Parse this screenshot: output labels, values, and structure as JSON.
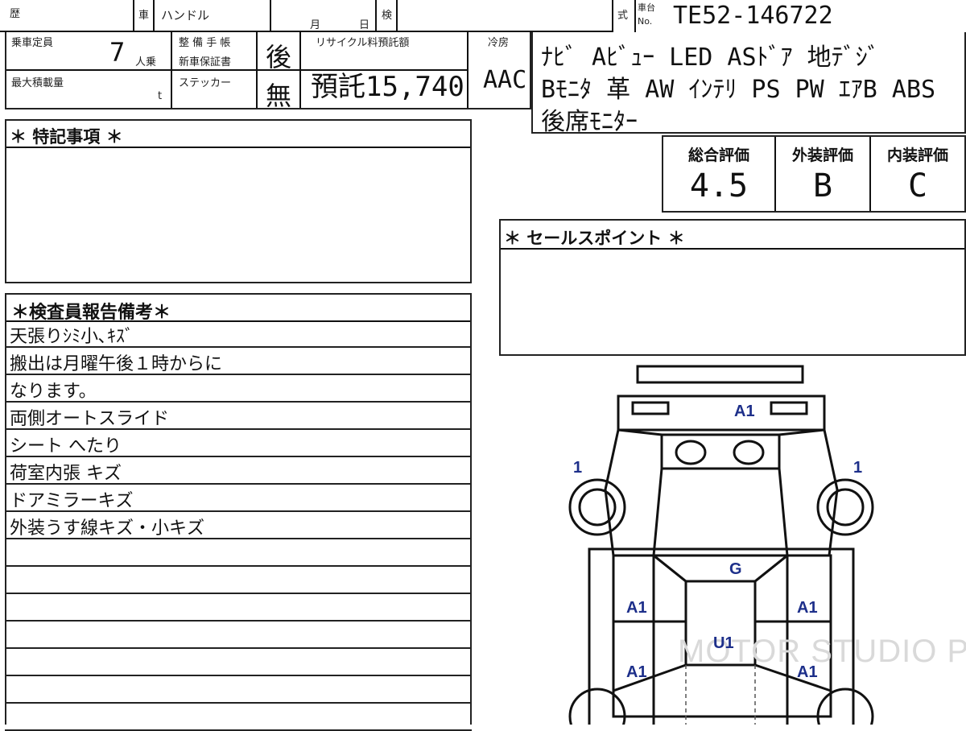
{
  "header": {
    "reki_label": "歴",
    "sha_label": "車",
    "handle_label": "ハンドル",
    "month_label": "月",
    "day_label": "日",
    "ken_label": "検",
    "shiki_label": "式",
    "chassis_label_top": "車台",
    "chassis_label_bottom": "No.",
    "chassis_no": "TE52-146722"
  },
  "specs": {
    "capacity_label": "乗車定員",
    "capacity_value": "7",
    "capacity_unit": "人乗",
    "maint_label_1": "整 備 手 帳",
    "maint_label_2": "新車保証書",
    "maint_value": "後",
    "load_label": "最大積載量",
    "load_unit": "t",
    "sticker_label": "ステッカー",
    "sticker_value": "無",
    "recycle_label": "リサイクル料預託額",
    "recycle_value": "預託15,740",
    "aircon_label": "冷房",
    "aircon_value": "AAC"
  },
  "equipment": {
    "line1": "ﾅﾋﾞ Aﾋﾞｭｰ LED ASﾄﾞｱ 地ﾃﾞｼﾞ",
    "line2": "Bﾓﾆﾀ 革 AW ｲﾝﾃﾘ PS PW ｴｱB ABS",
    "line3": "後席ﾓﾆﾀｰ"
  },
  "special_notes": {
    "title": "＊ 特記事項 ＊"
  },
  "grades": {
    "overall_label": "総合評価",
    "overall_value": "4.5",
    "exterior_label": "外装評価",
    "exterior_value": "B",
    "interior_label": "内装評価",
    "interior_value": "C"
  },
  "sales_point": {
    "title": "＊ セールスポイント ＊"
  },
  "inspector": {
    "title": "＊検査員報告備考＊",
    "lines": [
      "天張りｼﾐ小､ｷｽﾞ",
      "搬出は月曜午後１時からに",
      "なります。",
      "両側オートスライド",
      "シート へたり",
      "荷室内張 キズ",
      "ドアミラーキズ",
      "外装うす線キズ・小キズ"
    ]
  },
  "diagram": {
    "marks": {
      "hood": "A1",
      "left_front": "1",
      "right_front": "1",
      "windshield": "G",
      "left_door_front": "A1",
      "right_door_front": "A1",
      "roof": "U1",
      "left_door_rear": "A1",
      "right_door_rear": "A1"
    },
    "watermark": "MOTOR STUDIO PRO"
  }
}
